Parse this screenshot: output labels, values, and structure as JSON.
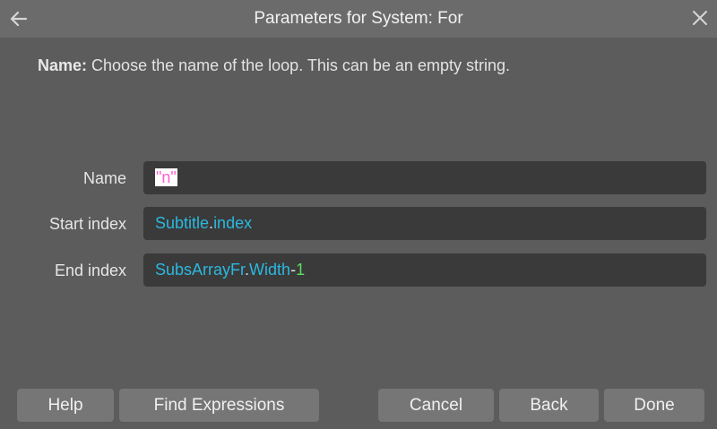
{
  "dialog": {
    "title": "Parameters for System: For",
    "help": {
      "term": "Name:",
      "text": " Choose the name of the loop. This can be an empty string."
    },
    "icons": {
      "back": "arrow-left-icon",
      "close": "close-icon"
    }
  },
  "fields": {
    "name": {
      "label": "Name",
      "tokens": [
        {
          "text": "\"n\"",
          "type": "string"
        }
      ]
    },
    "start_index": {
      "label": "Start index",
      "tokens": [
        {
          "text": "Subtitle",
          "type": "identifier"
        },
        {
          "text": ".",
          "type": "dot"
        },
        {
          "text": "index",
          "type": "identifier"
        }
      ]
    },
    "end_index": {
      "label": "End index",
      "tokens": [
        {
          "text": "SubsArrayFr",
          "type": "identifier"
        },
        {
          "text": ".",
          "type": "dot"
        },
        {
          "text": "Width",
          "type": "identifier"
        },
        {
          "text": "-",
          "type": "operator"
        },
        {
          "text": "1",
          "type": "number"
        }
      ]
    }
  },
  "buttons": {
    "help": "Help",
    "find_expressions": "Find Expressions",
    "cancel": "Cancel",
    "back": "Back",
    "done": "Done"
  },
  "colors": {
    "background": "#5c5c5c",
    "titlebar": "#6b6b6b",
    "field": "#3a3a3a",
    "button": "#767676",
    "identifier": "#2bb8e0",
    "string": "#ff5fd0",
    "number": "#5fdc5f"
  }
}
